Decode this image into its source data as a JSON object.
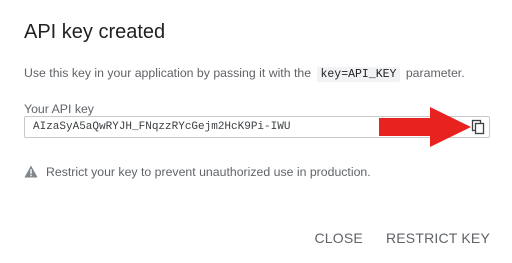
{
  "dialog": {
    "title": "API key created",
    "description": {
      "before": "Use this key in your application by passing it with the",
      "code": "key=API_KEY",
      "after": "parameter."
    },
    "field_label": "Your API key",
    "api_key": "AIzaSyA5aQwRYJH_FNqzzRYcGejm2HcK9Pi-IWU",
    "warning_text": "Restrict your key to prevent unauthorized use in production.",
    "buttons": {
      "close": "CLOSE",
      "restrict": "RESTRICT KEY"
    }
  },
  "icons": {
    "copy": "copy-icon",
    "warning": "warning-icon",
    "annotation_arrow": "red-arrow"
  },
  "colors": {
    "arrow": "#e8221e",
    "text_primary": "#202124",
    "text_secondary": "#5f6368"
  }
}
